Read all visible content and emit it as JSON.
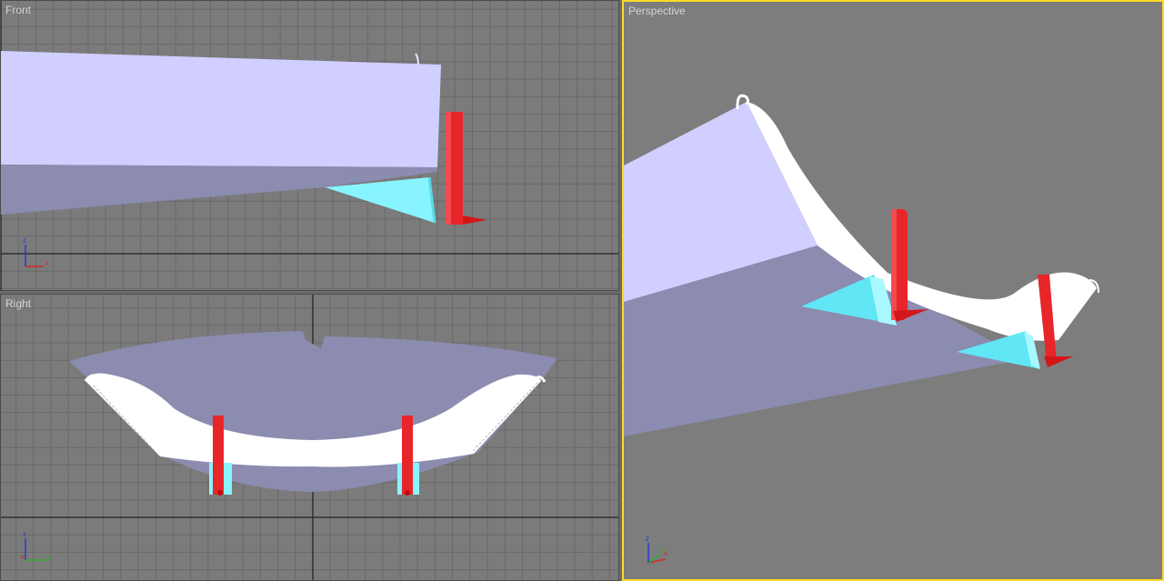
{
  "viewports": {
    "front": {
      "label": "Front",
      "axis_h": "x",
      "axis_v": "z"
    },
    "right": {
      "label": "Right",
      "axis_h": "y",
      "axis_v": "z"
    },
    "perspective": {
      "label": "Perspective",
      "axis_h": "x",
      "axis_v": "z",
      "axis_d": "y"
    }
  },
  "colors": {
    "viewport_bg": "#7b7b7b",
    "perspective_bg": "#7d7d7d",
    "grid_line": "#696969",
    "grid_axis": "#2f2f2f",
    "active_border": "#ffd92a",
    "hull_light": "#d0cfff",
    "hull_shade": "#8c8bb0",
    "foil": "#87f4ff",
    "post": "#e8262a",
    "wave_surface": "#ffffff"
  }
}
